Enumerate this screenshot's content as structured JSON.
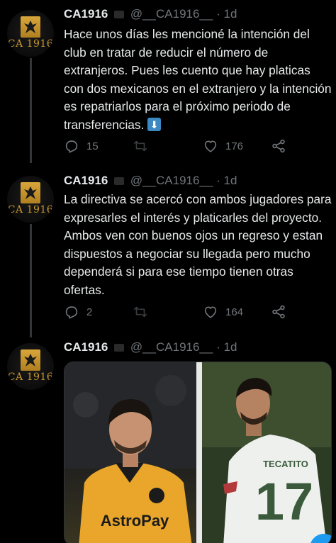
{
  "tweets": [
    {
      "avatar_text": "CA 1916",
      "name": "CA1916",
      "handle": "@__CA1916__",
      "dot": "·",
      "time": "1d",
      "text": "Hace unos días les mencioné la intención del club en tratar de reducir el número de extranjeros. Pues les cuento que hay platicas con dos mexicanos en el extranjero y la intención es repatriarlos para el próximo periodo de transferencias.",
      "emoji": "down-arrow-emoji",
      "replies": "15",
      "retweets": "",
      "likes": "176"
    },
    {
      "avatar_text": "CA 1916",
      "name": "CA1916",
      "handle": "@__CA1916__",
      "dot": "·",
      "time": "1d",
      "text": "La directiva se acercó con ambos jugadores para expresarles el interés y platicarles del proyecto. Ambos ven con buenos ojos un regreso y estan dispuestos a negociar su llegada pero mucho dependerá si para ese tiempo tienen otras ofertas.",
      "replies": "2",
      "retweets": "",
      "likes": "164"
    },
    {
      "avatar_text": "CA 1916",
      "name": "CA1916",
      "handle": "@__CA1916__",
      "dot": "·",
      "time": "1d",
      "media": {
        "left_jersey_sponsor": "AstroPay",
        "right_jersey_text": "TECATITO",
        "right_jersey_number": "17"
      }
    }
  ],
  "icons": {
    "reply": "reply-icon",
    "retweet": "retweet-icon",
    "like": "heart-icon",
    "share": "share-icon",
    "verified": "verified-badge-icon"
  },
  "colors": {
    "background": "#000000",
    "text": "#e7e9ea",
    "muted": "#71767b",
    "gold": "#c9982e"
  }
}
